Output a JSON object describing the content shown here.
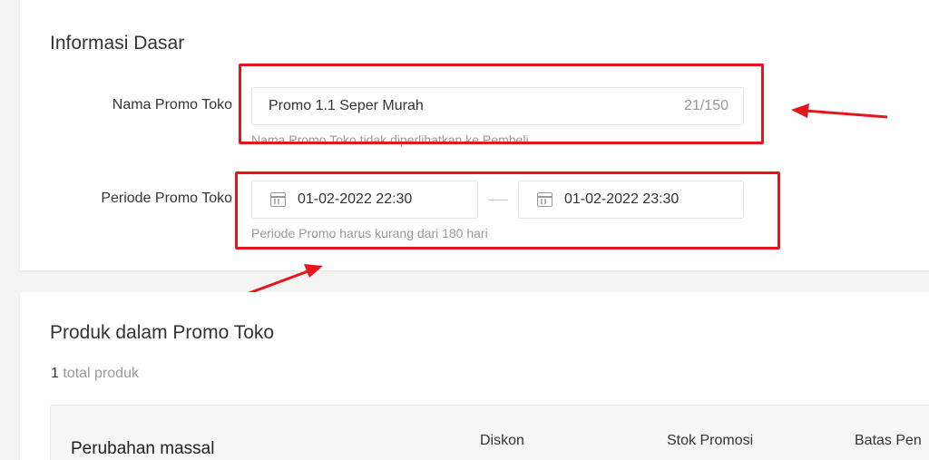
{
  "basic_info": {
    "title": "Informasi Dasar",
    "promo_name": {
      "label": "Nama Promo Toko",
      "value": "Promo 1.1 Seper Murah",
      "counter": "21/150",
      "hint": "Nama Promo Toko tidak diperlihatkan ke Pembeli."
    },
    "promo_period": {
      "label": "Periode Promo Toko",
      "start": "01-02-2022 22:30",
      "end": "01-02-2022 23:30",
      "hint": "Periode Promo harus kurang dari 180 hari"
    }
  },
  "products": {
    "title": "Produk dalam Promo Toko",
    "count_number": "1",
    "count_text": "total produk",
    "table": {
      "bulk_change": "Perubahan massal",
      "columns": [
        "Diskon",
        "Stok Promosi",
        "Batas Pen"
      ]
    }
  },
  "annotation_color": "#e8141b"
}
